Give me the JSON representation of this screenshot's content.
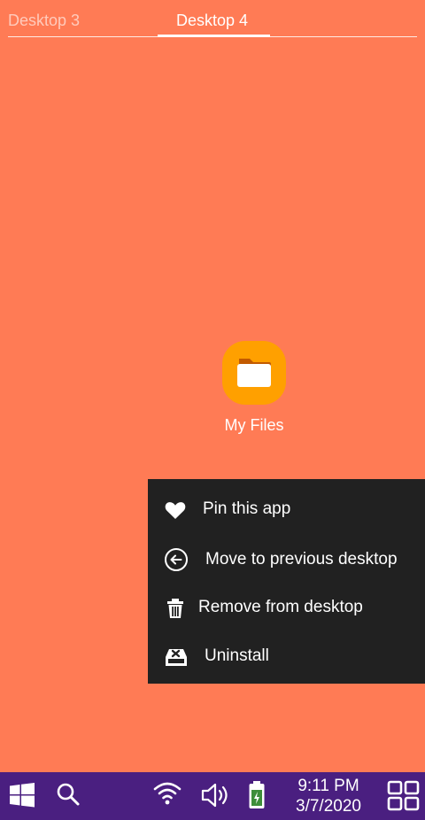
{
  "tabs": [
    {
      "label": "Desktop 3",
      "active": false
    },
    {
      "label": "Desktop 4",
      "active": true
    }
  ],
  "desktop": {
    "background": "#FF7B55",
    "apps": [
      {
        "label": "My Files",
        "icon": "folder-icon",
        "color": "#FFA000"
      }
    ]
  },
  "context_menu": {
    "items": [
      {
        "label": "Pin this app",
        "icon": "heart-icon"
      },
      {
        "label": "Move to previous desktop",
        "icon": "arrow-left-circle-icon"
      },
      {
        "label": "Remove from desktop",
        "icon": "trash-icon"
      },
      {
        "label": "Uninstall",
        "icon": "uninstall-icon"
      }
    ]
  },
  "taskbar": {
    "background": "#4A1F80",
    "time": "9:11 PM",
    "date": "3/7/2020",
    "icons": [
      "windows-start-icon",
      "search-icon",
      "wifi-icon",
      "volume-icon",
      "battery-icon",
      "multitask-icon"
    ]
  }
}
